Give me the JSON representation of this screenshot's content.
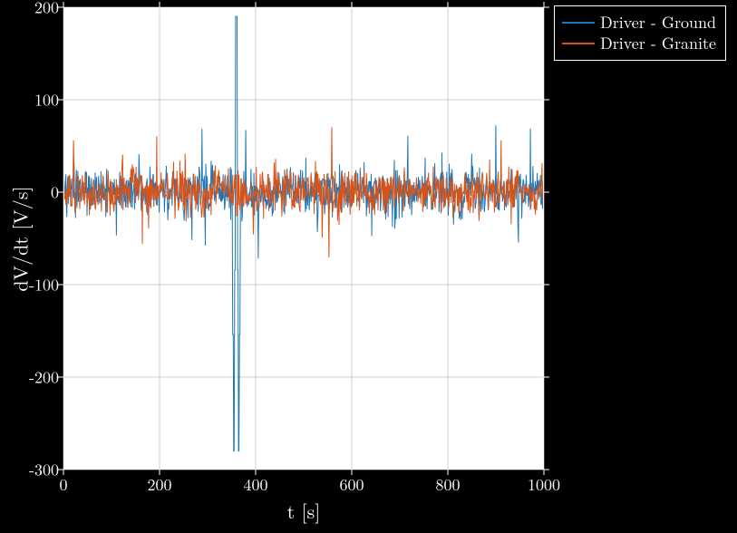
{
  "chart_data": {
    "type": "line",
    "title": "",
    "xlabel": "t [s]",
    "ylabel": "dV/dt [V/s]",
    "xlim": [
      0,
      1000
    ],
    "ylim": [
      -300,
      200
    ],
    "xticks": [
      0,
      200,
      400,
      600,
      800,
      1000
    ],
    "yticks": [
      -300,
      -200,
      -100,
      0,
      100,
      200
    ],
    "legend_position": "outside-top-right",
    "grid": true,
    "series": [
      {
        "name": "Driver - Ground",
        "color": "#1f77b4",
        "description": "Dense noisy signal centred near 0 with amplitude roughly ±60, one large transient near t≈360 reaching about +190 and −280."
      },
      {
        "name": "Driver - Granite",
        "color": "#d95319",
        "description": "Dense noisy signal centred near 0 with amplitude roughly ±55, no large transient."
      }
    ],
    "series_data": {
      "n_points": 1000,
      "noise_amp": [
        60,
        55
      ],
      "spike": {
        "series": 0,
        "t": 360,
        "hi": 190,
        "lo": -280
      }
    }
  },
  "legend": {
    "items": [
      {
        "label": "Driver - Ground",
        "color": "#1f77b4"
      },
      {
        "label": "Driver - Granite",
        "color": "#d95319"
      }
    ]
  },
  "axes": {
    "xlabel": "t [s]",
    "ylabel": "dV/dt [V/s]",
    "xticks": [
      "0",
      "200",
      "400",
      "600",
      "800",
      "1000"
    ],
    "yticks": [
      "-300",
      "-200",
      "-100",
      "0",
      "100",
      "200"
    ]
  }
}
